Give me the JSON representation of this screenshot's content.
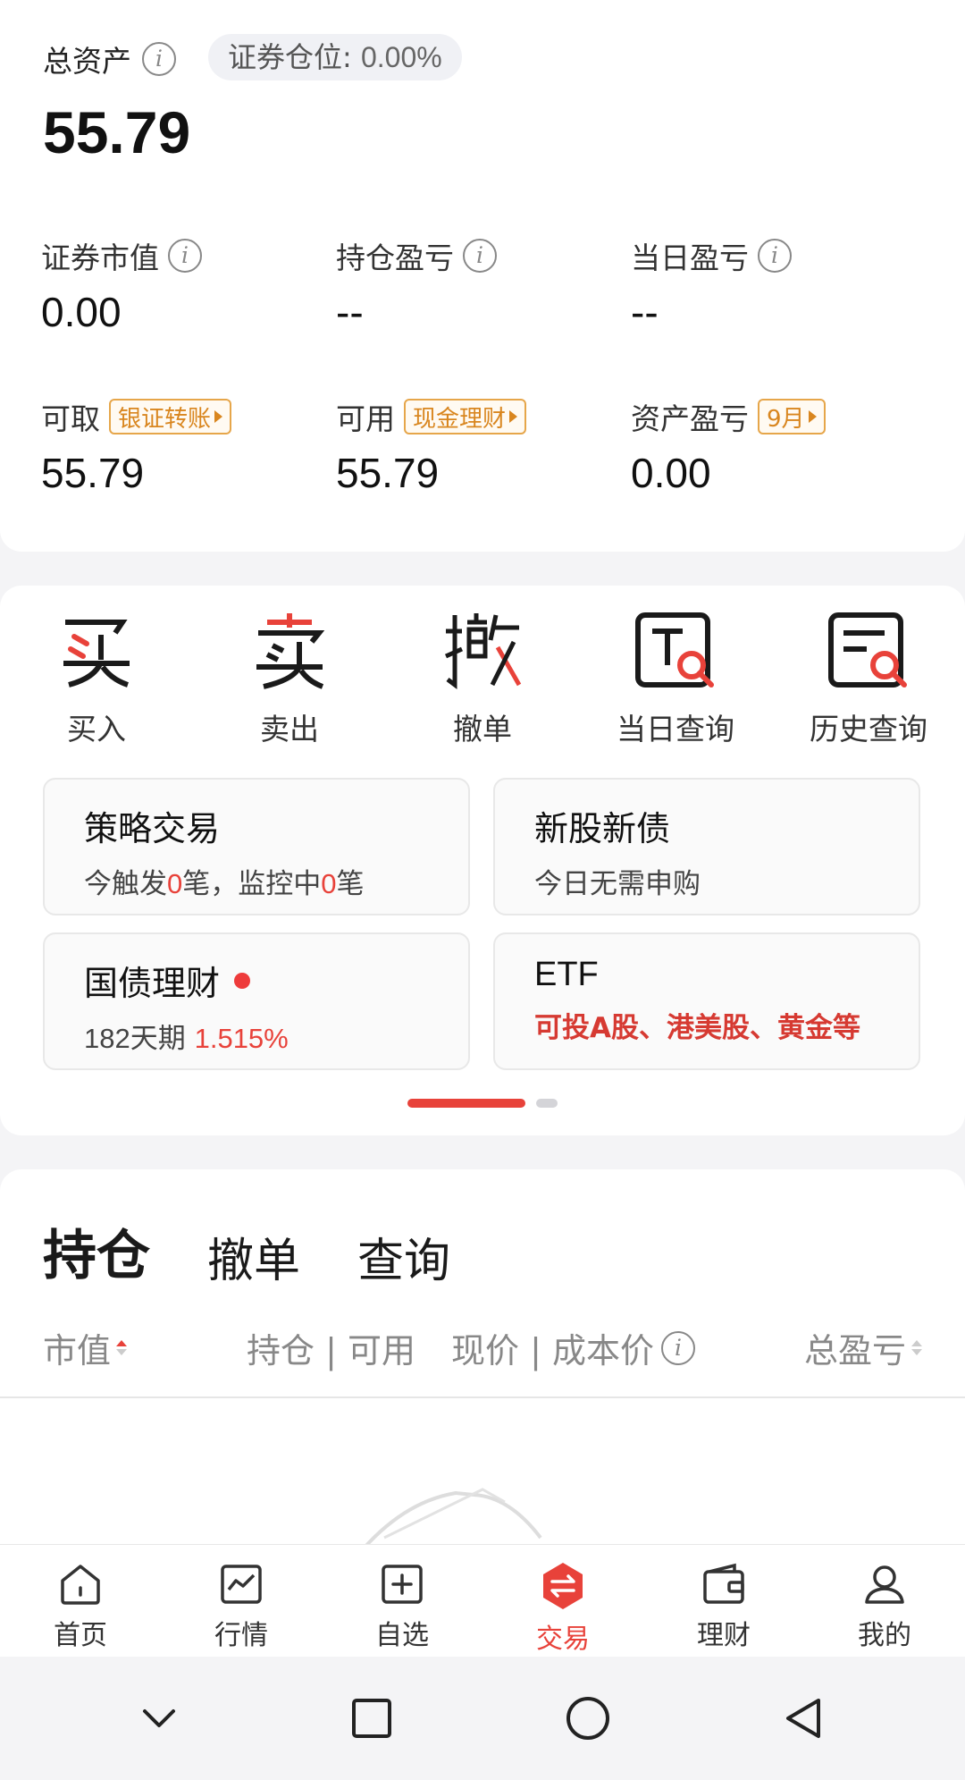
{
  "assets": {
    "total_label": "总资产",
    "position_label": "证券仓位:",
    "position_value": "0.00%",
    "total_value": "55.79",
    "stats_row1": [
      {
        "label": "证券市值",
        "value": "0.00"
      },
      {
        "label": "持仓盈亏",
        "value": "--"
      },
      {
        "label": "当日盈亏",
        "value": "--"
      }
    ],
    "stats_row2": [
      {
        "label": "可取",
        "tag": "银证转账",
        "value": "55.79"
      },
      {
        "label": "可用",
        "tag": "现金理财",
        "value": "55.79"
      },
      {
        "label": "资产盈亏",
        "tag": "9月",
        "value": "0.00"
      }
    ]
  },
  "actions": [
    {
      "glyph": "买",
      "label": "买入",
      "icon": "buy-icon"
    },
    {
      "glyph": "卖",
      "label": "卖出",
      "icon": "sell-icon"
    },
    {
      "glyph": "撤",
      "label": "撤单",
      "icon": "cancel-order-icon"
    },
    {
      "glyph": "T",
      "label": "当日查询",
      "icon": "today-query-icon"
    },
    {
      "glyph": "≡",
      "label": "历史查询",
      "icon": "history-query-icon"
    }
  ],
  "tiles": {
    "strategy": {
      "title": "策略交易",
      "sub_a": "今触发",
      "count_a": "0",
      "sub_b": "笔，监控中",
      "count_b": "0",
      "sub_c": "笔"
    },
    "ipo": {
      "title": "新股新债",
      "sub": "今日无需申购"
    },
    "bond": {
      "title": "国债理财",
      "period_num": "182",
      "period_unit": "天期",
      "rate": "1.515%"
    },
    "etf": {
      "title": "ETF",
      "sub": "可投A股、港美股、黄金等"
    }
  },
  "holdings": {
    "tabs": [
      "持仓",
      "撤单",
      "查询"
    ],
    "columns": {
      "market_value": "市值",
      "hold_avail": "持仓 | 可用",
      "price_cost": "现价 | 成本价",
      "total_pl": "总盈亏"
    }
  },
  "nav": [
    {
      "label": "首页",
      "icon": "home-icon"
    },
    {
      "label": "行情",
      "icon": "market-icon"
    },
    {
      "label": "自选",
      "icon": "watchlist-icon"
    },
    {
      "label": "交易",
      "icon": "trade-icon"
    },
    {
      "label": "理财",
      "icon": "wealth-icon"
    },
    {
      "label": "我的",
      "icon": "profile-icon"
    }
  ],
  "colors": {
    "accent": "#e8423a",
    "tag_orange": "#d9861f"
  }
}
